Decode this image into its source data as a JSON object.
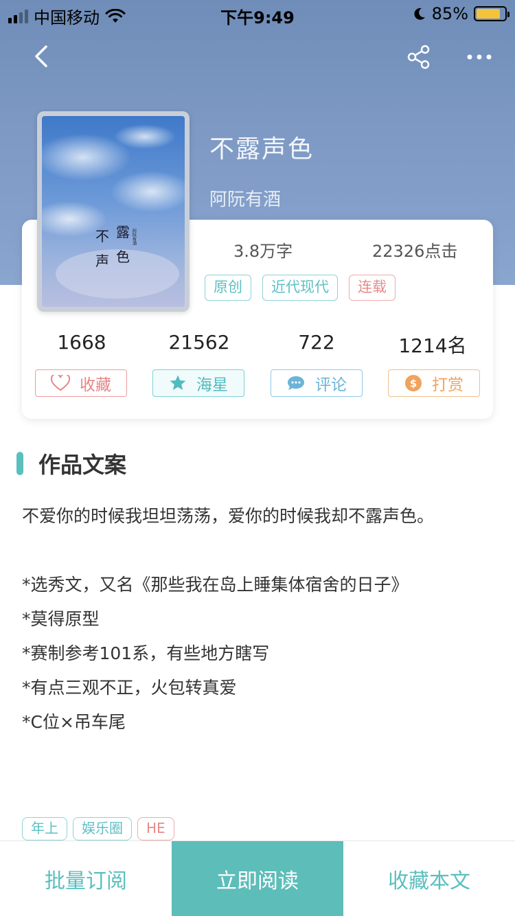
{
  "status_bar": {
    "carrier": "中国移动",
    "time": "下午9:49",
    "battery": "85%"
  },
  "nav": {
    "back_icon": "chevron-left",
    "share_icon": "share",
    "more_icon": "more-horizontal"
  },
  "book": {
    "title": "不露声色",
    "author": "阿阮有酒",
    "word_count": "3.8万字",
    "clicks": "22326点击",
    "tags": [
      "原创",
      "近代现代",
      "连载"
    ],
    "cover_text": "不露声色",
    "cover_subtext": "阿阮有酒"
  },
  "stats": {
    "favorites": "1668",
    "starfish": "21562",
    "comments": "722",
    "rank": "1214名"
  },
  "actions": {
    "favorite": "收藏",
    "starfish": "海星",
    "comment": "评论",
    "tip": "打赏"
  },
  "section": {
    "title": "作品文案"
  },
  "description": [
    "不爱你的时候我坦坦荡荡，爱你的时候我却不露声色。",
    "*选秀文，又名《那些我在岛上睡集体宿舍的日子》",
    "*莫得原型",
    "*赛制参考101系，有些地方瞎写",
    "*有点三观不正，火包转真爱",
    "*C位×吊车尾"
  ],
  "bottom_tags": [
    "年上",
    "娱乐圈",
    "HE"
  ],
  "bottom_bar": {
    "batch": "批量订阅",
    "read": "立即阅读",
    "collect": "收藏本文"
  },
  "colors": {
    "accent": "#5dbdb9",
    "hero_top": "#6f8db8",
    "hero_bottom": "#8aa6cf",
    "pink": "#e88a8a",
    "orange": "#f0a35c"
  }
}
